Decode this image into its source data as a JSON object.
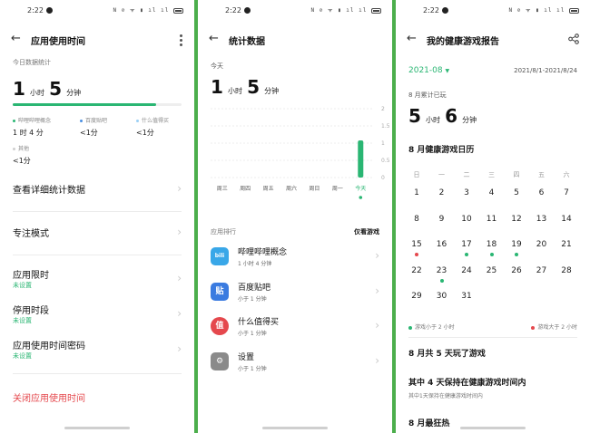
{
  "status_bar": {
    "time": "2:22",
    "icons_text": "N ⊘ ᯤ ▮ ıl ıl"
  },
  "screen1": {
    "title": "应用使用时间",
    "today_label": "今日数据统计",
    "total": {
      "hours": "1",
      "hours_unit": "小时",
      "minutes": "5",
      "minutes_unit": "分钟"
    },
    "progress_fraction": 0.85,
    "apps": [
      {
        "name": "哔哩哔哩概念",
        "value": "1 时 4 分",
        "color": "#2ab673"
      },
      {
        "name": "百度贴吧",
        "value": "<1分",
        "color": "#4a90e2"
      },
      {
        "name": "什么值得买",
        "value": "<1分",
        "color": "#9bd0f5"
      },
      {
        "name": "其他",
        "value": "<1分",
        "color": "#cfcfcf"
      }
    ],
    "menu": [
      {
        "label": "查看详细统计数据",
        "sub": ""
      },
      {
        "label": "专注模式",
        "sub": ""
      },
      {
        "label": "应用限时",
        "sub": "未设置"
      },
      {
        "label": "停用时段",
        "sub": "未设置"
      },
      {
        "label": "应用使用时间密码",
        "sub": "未设置"
      }
    ],
    "close_label": "关闭应用使用时间"
  },
  "screen2": {
    "title": "统计数据",
    "today_label": "今天",
    "total": {
      "hours": "1",
      "hours_unit": "小时",
      "minutes": "5",
      "minutes_unit": "分钟"
    },
    "chart_data": {
      "type": "bar",
      "categories": [
        "周三",
        "周四",
        "周五",
        "周六",
        "周日",
        "周一",
        "今天"
      ],
      "values": [
        0,
        0,
        0,
        0,
        0,
        0,
        1.08
      ],
      "yticks": [
        "2",
        "1.5",
        "1",
        "0.5",
        "0"
      ],
      "ylim": [
        0,
        2
      ],
      "bar_color": "#2ab673"
    },
    "ranking_label": "应用排行",
    "filter_label": "仅看游戏",
    "apps": [
      {
        "name": "哔哩哔哩概念",
        "time": "1 小时 4 分钟",
        "icon": "bilibili-icon",
        "color": "#39a7e8",
        "glyph": "bili"
      },
      {
        "name": "百度贴吧",
        "time": "小于 1 分钟",
        "icon": "tieba-icon",
        "color": "#3a7be0",
        "glyph": "贴"
      },
      {
        "name": "什么值得买",
        "time": "小于 1 分钟",
        "icon": "smzdm-icon",
        "color": "#e5484d",
        "glyph": "值"
      },
      {
        "name": "设置",
        "time": "小于 1 分钟",
        "icon": "gear-icon",
        "color": "#8a8a8a",
        "glyph": "⚙"
      }
    ]
  },
  "screen3": {
    "title": "我的健康游戏报告",
    "month": "2021-08",
    "range": "2021/8/1-2021/8/24",
    "played_label": "8 月累计已玩",
    "total": {
      "hours": "5",
      "hours_unit": "小时",
      "minutes": "6",
      "minutes_unit": "分钟"
    },
    "calendar_title": "8 月健康游戏日历",
    "weekdays": [
      "日",
      "一",
      "二",
      "三",
      "四",
      "五",
      "六"
    ],
    "weeks": [
      [
        {
          "d": "1"
        },
        {
          "d": "2"
        },
        {
          "d": "3"
        },
        {
          "d": "4"
        },
        {
          "d": "5"
        },
        {
          "d": "6"
        },
        {
          "d": "7"
        }
      ],
      [
        {
          "d": "8"
        },
        {
          "d": "9"
        },
        {
          "d": "10"
        },
        {
          "d": "11"
        },
        {
          "d": "12"
        },
        {
          "d": "13"
        },
        {
          "d": "14"
        }
      ],
      [
        {
          "d": "15",
          "dot": "red"
        },
        {
          "d": "16"
        },
        {
          "d": "17",
          "dot": "green"
        },
        {
          "d": "18",
          "dot": "green"
        },
        {
          "d": "19",
          "dot": "green"
        },
        {
          "d": "20"
        },
        {
          "d": "21"
        }
      ],
      [
        {
          "d": "22"
        },
        {
          "d": "23",
          "dot": "green"
        },
        {
          "d": "24"
        },
        {
          "d": "25"
        },
        {
          "d": "26"
        },
        {
          "d": "27"
        },
        {
          "d": "28"
        }
      ],
      [
        {
          "d": "29"
        },
        {
          "d": "30"
        },
        {
          "d": "31"
        }
      ]
    ],
    "legend_green": "游戏小于 2 小时",
    "legend_red": "游戏大于 2 小时",
    "summary_days": "8 月共 5 天玩了游戏",
    "healthy_title": "其中 4 天保持在健康游戏时间内",
    "healthy_sub": "其中1天保持在健康游戏时间内",
    "hot_title": "8 月最狂热",
    "colors": {
      "green": "#2ab673",
      "red": "#e5484d"
    }
  }
}
